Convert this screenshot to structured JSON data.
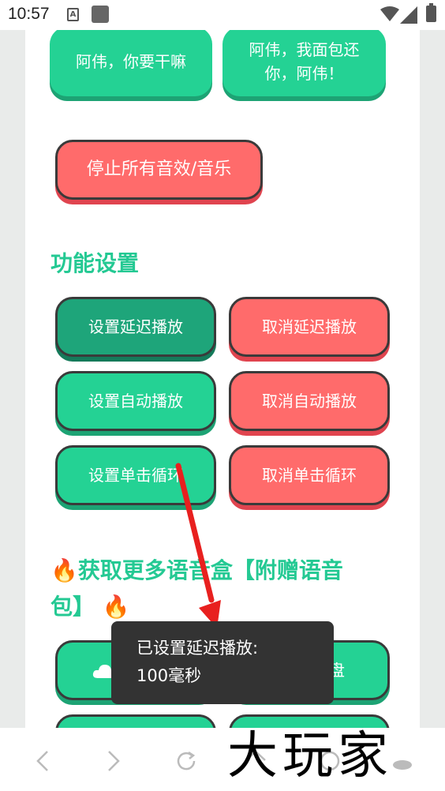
{
  "status_bar": {
    "time": "10:57",
    "app_icon_letter": "A"
  },
  "top_buttons": [
    {
      "label": "阿伟，你要干嘛"
    },
    {
      "label": "阿伟，我面包还\n你，阿伟！"
    }
  ],
  "stop_button": {
    "label": "停止所有音效/音乐"
  },
  "settings": {
    "title": "功能设置",
    "buttons": [
      {
        "label": "设置延迟播放"
      },
      {
        "label": "取消延迟播放"
      },
      {
        "label": "设置自动播放"
      },
      {
        "label": "取消自动播放"
      },
      {
        "label": "设置单击循环"
      },
      {
        "label": "取消单击循环"
      }
    ]
  },
  "more": {
    "title_line1": "获取更多语音盒【附赠语音",
    "title_line2": "包】",
    "fire_icon": "🔥",
    "partial_right_label": "盘"
  },
  "toast": {
    "line1": "已设置延迟播放:",
    "line2": "100毫秒"
  },
  "nav": {
    "back": "‹",
    "forward": "›"
  },
  "watermark": "大玩家",
  "colors": {
    "green": "#24d294",
    "red": "#ff6b6b",
    "title_green": "#24c993",
    "arrow": "#e8201f"
  }
}
